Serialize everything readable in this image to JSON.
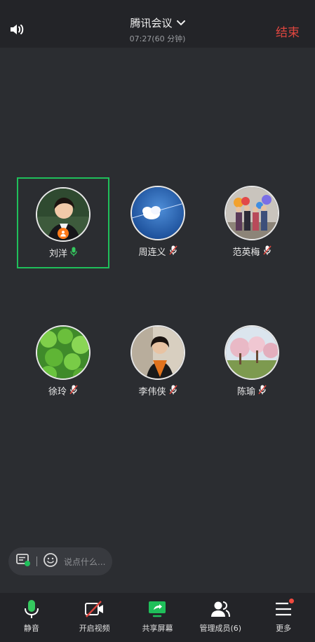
{
  "header": {
    "title": "腾讯会议",
    "subtitle": "07:27(60 分钟)",
    "end_label": "结束"
  },
  "members": [
    {
      "name": "刘洋",
      "mic": "on",
      "host": true,
      "active": true,
      "avatar": "teacher-portrait"
    },
    {
      "name": "周连义",
      "mic": "muted",
      "host": false,
      "active": false,
      "avatar": "blue-sky-cloud"
    },
    {
      "name": "范英梅",
      "mic": "muted",
      "host": false,
      "active": false,
      "avatar": "group-photo-balloons"
    },
    {
      "name": "徐玲",
      "mic": "muted",
      "host": false,
      "active": false,
      "avatar": "green-clover"
    },
    {
      "name": "李伟侠",
      "mic": "muted",
      "host": false,
      "active": false,
      "avatar": "woman-scarf-portrait"
    },
    {
      "name": "陈瑜",
      "mic": "muted",
      "host": false,
      "active": false,
      "avatar": "blossom-trees"
    }
  ],
  "chat": {
    "placeholder": "说点什么..."
  },
  "toolbar": {
    "mute_label": "静音",
    "video_label": "开启视频",
    "share_label": "共享屏幕",
    "members_label": "管理成员(6)",
    "more_label": "更多"
  },
  "colors": {
    "accent_green": "#1fbf5a",
    "end_red": "#e0463f",
    "host_orange": "#ff7a1a",
    "background": "#2b2d31"
  }
}
